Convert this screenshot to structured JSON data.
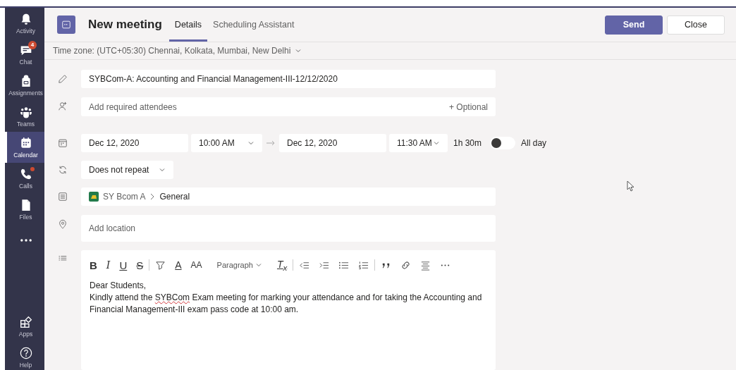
{
  "rail": {
    "items": [
      {
        "kind": "activity",
        "label": "Activity",
        "selected": false,
        "dot": false
      },
      {
        "kind": "chat",
        "label": "Chat",
        "selected": false,
        "dot": false,
        "badge": "4"
      },
      {
        "kind": "assignments",
        "label": "Assignments",
        "selected": false,
        "dot": false
      },
      {
        "kind": "teams",
        "label": "Teams",
        "selected": false,
        "dot": false
      },
      {
        "kind": "calendar",
        "label": "Calendar",
        "selected": true,
        "dot": false
      },
      {
        "kind": "calls",
        "label": "Calls",
        "selected": false,
        "dot": true
      },
      {
        "kind": "files",
        "label": "Files",
        "selected": false,
        "dot": false
      },
      {
        "kind": "more",
        "selected": false,
        "dot": false
      }
    ],
    "bottom_items": [
      {
        "kind": "apps",
        "label": "Apps",
        "selected": false
      },
      {
        "kind": "help",
        "label": "Help",
        "selected": false
      }
    ]
  },
  "header": {
    "title": "New meeting",
    "tabs": [
      {
        "label": "Details",
        "selected": true
      },
      {
        "label": "Scheduling Assistant",
        "selected": false
      }
    ],
    "buttons": [
      {
        "kind": "primary",
        "label": "Send"
      },
      {
        "kind": "secondary",
        "label": "Close"
      }
    ]
  },
  "timezone": "Time zone: (UTC+05:30) Chennai, Kolkata, Mumbai, New Delhi",
  "form": {
    "title": {
      "value": "SYBCom-A: Accounting and Financial Management-III-12/12/2020"
    },
    "attendees": {
      "placeholder": "Add required attendees",
      "optional_link": "+ Optional"
    },
    "schedule": {
      "start_date": "Dec 12, 2020",
      "start_time": "10:00 AM",
      "end_date": "Dec 12, 2020",
      "end_time": "11:30 AM",
      "duration": "1h 30m",
      "all_day": {
        "label": "All day",
        "on": false
      }
    },
    "repeat": {
      "value": "Does not repeat"
    },
    "channel": {
      "team": "SY Bcom A",
      "channel": "General"
    },
    "location": {
      "placeholder": "Add location"
    },
    "editor": {
      "toolbar": [
        {
          "kind": "bold",
          "text": "B"
        },
        {
          "kind": "italic",
          "text": "I"
        },
        {
          "kind": "underline",
          "text": "U"
        },
        {
          "kind": "strike",
          "text": "S"
        },
        {
          "kind": "divider"
        },
        {
          "kind": "highlight"
        },
        {
          "kind": "font-color",
          "text": "A"
        },
        {
          "kind": "font-size",
          "text": "AA"
        },
        {
          "kind": "dropdown",
          "text": "Paragraph"
        },
        {
          "kind": "clear-format",
          "text": "T$_{x}$"
        },
        {
          "kind": "divider"
        },
        {
          "kind": "outdent"
        },
        {
          "kind": "indent"
        },
        {
          "kind": "bullets"
        },
        {
          "kind": "numbers"
        },
        {
          "kind": "divider"
        },
        {
          "kind": "quote"
        },
        {
          "kind": "link"
        },
        {
          "kind": "align"
        },
        {
          "kind": "more"
        }
      ],
      "body": [
        {
          "segments": [
            {
              "text": "Dear Students,",
              "misspelled": false
            }
          ]
        },
        {
          "segments": [
            {
              "text": "Kindly attend the ",
              "misspelled": false
            },
            {
              "text": "SYBCom",
              "misspelled": true
            },
            {
              "text": "  Exam meeting for marking your attendance and  for taking the Accounting and Financial Management-III exam pass code at 10:00 am.",
              "misspelled": false
            }
          ]
        }
      ]
    }
  }
}
